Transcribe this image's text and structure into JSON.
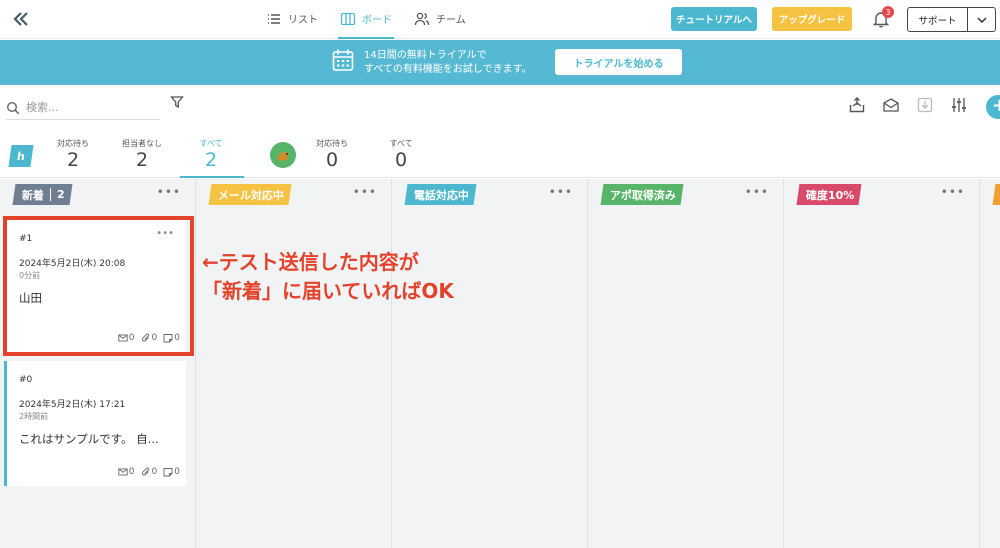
{
  "topbar": {
    "tabs": [
      {
        "label": "リスト",
        "icon": "list-icon"
      },
      {
        "label": "ボード",
        "icon": "board-icon",
        "active": true
      },
      {
        "label": "チーム",
        "icon": "team-icon"
      }
    ],
    "tutorial_label": "チュートリアルへ",
    "upgrade_label": "アップグレード",
    "notification_count": "3",
    "support_label": "サポート"
  },
  "banner": {
    "line1": "14日間の無料トライアルで",
    "line2": "すべての有料機能をお試しできます。",
    "button_label": "トライアルを始める"
  },
  "search": {
    "placeholder": "検索..."
  },
  "stats": {
    "badge": "h",
    "items": [
      {
        "label": "対応待ち",
        "value": "2"
      },
      {
        "label": "担当者なし",
        "value": "2"
      },
      {
        "label": "すべて",
        "value": "2",
        "active": true
      },
      {
        "label": "対応待ち",
        "value": "0"
      },
      {
        "label": "すべて",
        "value": "0"
      }
    ]
  },
  "columns": [
    {
      "label": "新着",
      "count": "2",
      "color": "#6f7f91"
    },
    {
      "label": "メール対応中",
      "color": "#f5c242"
    },
    {
      "label": "電話対応中",
      "color": "#4cb8cf"
    },
    {
      "label": "アポ取得済み",
      "color": "#58b468"
    },
    {
      "label": "確度10%",
      "color": "#d94a6a"
    }
  ],
  "cards": [
    {
      "id": "#1",
      "date": "2024年5月2日(木) 20:08",
      "ago": "0分前",
      "name": "山田",
      "mail": "0",
      "attach": "0",
      "note": "0"
    },
    {
      "id": "#0",
      "date": "2024年5月2日(木) 17:21",
      "ago": "2時間前",
      "name": "これはサンプルです。 自...",
      "mail": "0",
      "attach": "0",
      "note": "0"
    }
  ],
  "annotation": {
    "line1": "←テスト送信した内容が",
    "line2": "「新着」に届いていればOK"
  }
}
